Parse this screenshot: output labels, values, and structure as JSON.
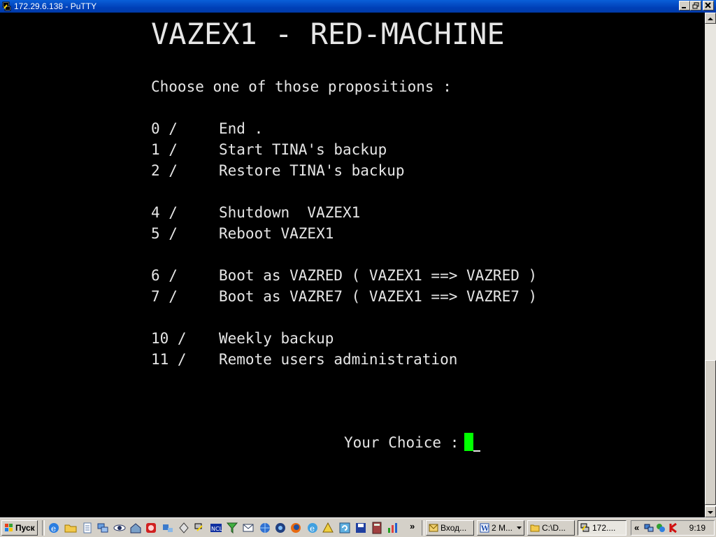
{
  "window": {
    "title": "172.29.6.138 - PuTTY",
    "icon": "putty-icon",
    "buttons": [
      "minimize",
      "restore",
      "close"
    ]
  },
  "terminal": {
    "heading": "VAZEX1 - RED-MACHINE",
    "instruction": "Choose one of those propositions :",
    "menu": [
      {
        "num": "0 /",
        "label": "End ."
      },
      {
        "num": "1 /",
        "label": "Start TINA's backup"
      },
      {
        "num": "2 /",
        "label": "Restore TINA's backup"
      },
      {
        "num": "4 /",
        "label": "Shutdown  VAZEX1"
      },
      {
        "num": "5 /",
        "label": "Reboot VAZEX1"
      },
      {
        "num": "6 /",
        "label": "Boot as VAZRED ( VAZEX1 ==> VAZRED )"
      },
      {
        "num": "7 /",
        "label": "Boot as VAZRE7 ( VAZEX1 ==> VAZRE7 )"
      },
      {
        "num": "10 /",
        "label": "Weekly backup"
      },
      {
        "num": "11 /",
        "label": "Remote users administration"
      }
    ],
    "prompt": "Your Choice :",
    "colors": {
      "background": "#000000",
      "text": "#e6e6e6",
      "cursor": "#00ff00"
    }
  },
  "taskbar": {
    "start_label": "Пуск",
    "quicklaunch_icons": [
      "ie-icon",
      "folder-icon",
      "notepad-icon",
      "network-icon",
      "eye-icon",
      "house-icon",
      "red-app-icon",
      "net-icon",
      "plugin-icon",
      "key-icon",
      "nc-icon",
      "filter-icon",
      "mail-icon",
      "globe-icon",
      "media-icon",
      "firefox-icon",
      "ie2-icon",
      "drive-icon",
      "refresh-icon",
      "save-icon",
      "calc-icon",
      "chart-icon"
    ],
    "more_label": "»",
    "tasks": [
      {
        "label": "Вход...",
        "icon": "outlook-icon",
        "active": false
      },
      {
        "label": "2 M...",
        "icon": "word-icon",
        "active": false
      },
      {
        "label": "C:\\D...",
        "icon": "folder-icon",
        "active": false
      },
      {
        "label": "172....",
        "icon": "putty-icon",
        "active": true
      }
    ],
    "tray": {
      "collapse_label": "«",
      "icons": [
        "network-tray-icon",
        "connection-tray-icon",
        "kaspersky-icon"
      ],
      "clock": "9:19"
    }
  }
}
